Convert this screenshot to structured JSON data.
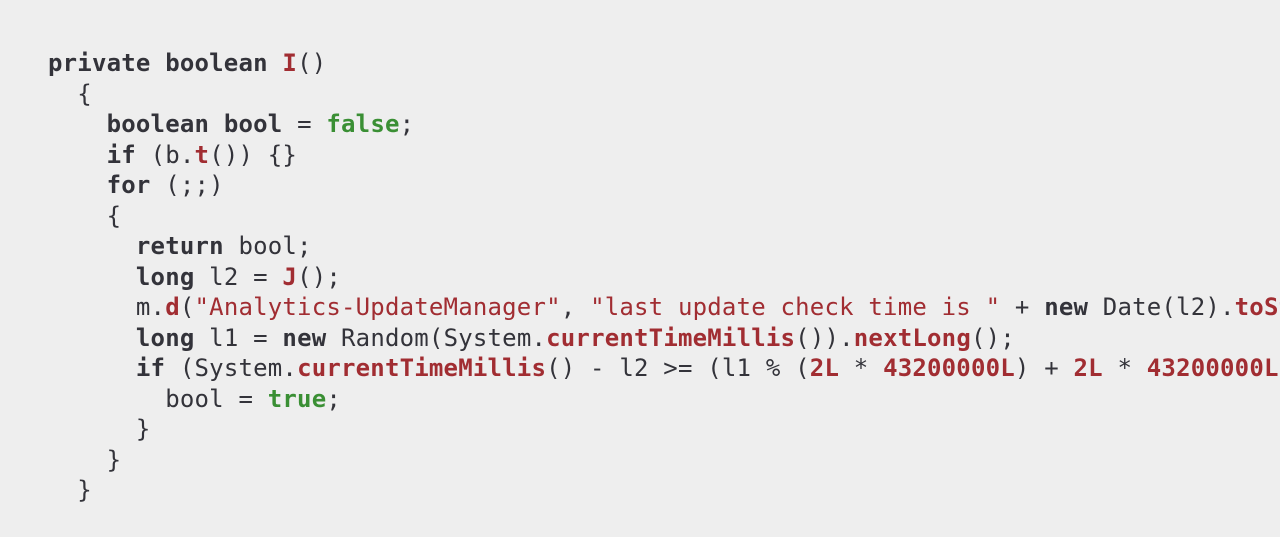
{
  "code": {
    "tokens": [
      {
        "cls": "k",
        "t": "private"
      },
      {
        "cls": "o",
        "t": " "
      },
      {
        "cls": "k",
        "t": "boolean"
      },
      {
        "cls": "o",
        "t": " "
      },
      {
        "cls": "m",
        "t": "I"
      },
      {
        "cls": "o",
        "t": "()\n"
      },
      {
        "cls": "o",
        "t": "  {\n"
      },
      {
        "cls": "o",
        "t": "    "
      },
      {
        "cls": "k",
        "t": "boolean"
      },
      {
        "cls": "o",
        "t": " "
      },
      {
        "cls": "k",
        "t": "bool"
      },
      {
        "cls": "o",
        "t": " = "
      },
      {
        "cls": "b",
        "t": "false"
      },
      {
        "cls": "o",
        "t": ";\n"
      },
      {
        "cls": "o",
        "t": "    "
      },
      {
        "cls": "k",
        "t": "if"
      },
      {
        "cls": "o",
        "t": " (b."
      },
      {
        "cls": "m",
        "t": "t"
      },
      {
        "cls": "o",
        "t": "()) {}\n"
      },
      {
        "cls": "o",
        "t": "    "
      },
      {
        "cls": "k",
        "t": "for"
      },
      {
        "cls": "o",
        "t": " (;;)\n"
      },
      {
        "cls": "o",
        "t": "    {\n"
      },
      {
        "cls": "o",
        "t": "      "
      },
      {
        "cls": "k",
        "t": "return"
      },
      {
        "cls": "o",
        "t": " bool;\n"
      },
      {
        "cls": "o",
        "t": "      "
      },
      {
        "cls": "k",
        "t": "long"
      },
      {
        "cls": "o",
        "t": " l2 = "
      },
      {
        "cls": "m",
        "t": "J"
      },
      {
        "cls": "o",
        "t": "();\n"
      },
      {
        "cls": "o",
        "t": "      m."
      },
      {
        "cls": "m",
        "t": "d"
      },
      {
        "cls": "o",
        "t": "("
      },
      {
        "cls": "s",
        "t": "\"Analytics-UpdateManager\""
      },
      {
        "cls": "o",
        "t": ", "
      },
      {
        "cls": "s",
        "t": "\"last update check time is \""
      },
      {
        "cls": "o",
        "t": " + "
      },
      {
        "cls": "k",
        "t": "new"
      },
      {
        "cls": "o",
        "t": " Date(l2)."
      },
      {
        "cls": "m",
        "t": "toStrin"
      },
      {
        "cls": "o",
        "t": "\n"
      },
      {
        "cls": "o",
        "t": "      "
      },
      {
        "cls": "k",
        "t": "long"
      },
      {
        "cls": "o",
        "t": " l1 = "
      },
      {
        "cls": "k",
        "t": "new"
      },
      {
        "cls": "o",
        "t": " Random(System."
      },
      {
        "cls": "m",
        "t": "currentTimeMillis"
      },
      {
        "cls": "o",
        "t": "())."
      },
      {
        "cls": "m",
        "t": "nextLong"
      },
      {
        "cls": "o",
        "t": "();\n"
      },
      {
        "cls": "o",
        "t": "      "
      },
      {
        "cls": "k",
        "t": "if"
      },
      {
        "cls": "o",
        "t": " (System."
      },
      {
        "cls": "m",
        "t": "currentTimeMillis"
      },
      {
        "cls": "o",
        "t": "() - l2 >= (l1 % ("
      },
      {
        "cls": "n",
        "t": "2L"
      },
      {
        "cls": "o",
        "t": " * "
      },
      {
        "cls": "n",
        "t": "43200000L"
      },
      {
        "cls": "o",
        "t": ") + "
      },
      {
        "cls": "n",
        "t": "2L"
      },
      {
        "cls": "o",
        "t": " * "
      },
      {
        "cls": "n",
        "t": "43200000L"
      },
      {
        "cls": "o",
        "t": ") % \n"
      },
      {
        "cls": "o",
        "t": "        bool = "
      },
      {
        "cls": "b",
        "t": "true"
      },
      {
        "cls": "o",
        "t": ";\n"
      },
      {
        "cls": "o",
        "t": "      }\n"
      },
      {
        "cls": "o",
        "t": "    }\n"
      },
      {
        "cls": "o",
        "t": "  }\n"
      }
    ]
  }
}
